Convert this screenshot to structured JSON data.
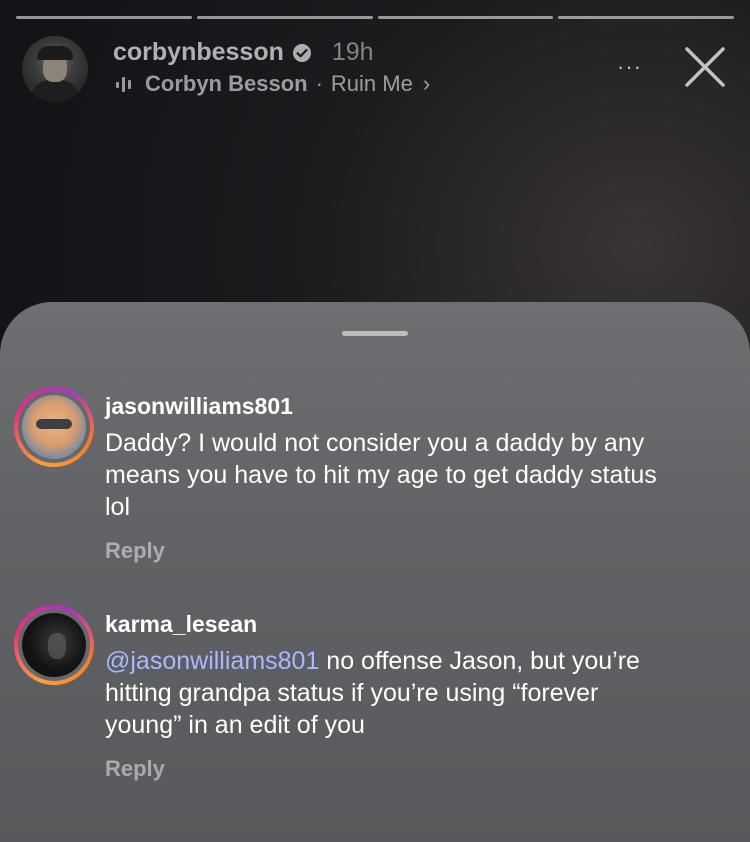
{
  "story": {
    "username": "corbynbesson",
    "time": "19h",
    "music_artist": "Corbyn Besson",
    "music_separator": "·",
    "music_song": "Ruin Me",
    "more_label": "···",
    "progress_segments": 4,
    "progress_done": 4
  },
  "comments": [
    {
      "username": "jasonwilliams801",
      "mention": "",
      "text": "Daddy? I would not consider you a daddy by any means you have to hit my age to get daddy status lol",
      "reply_label": "Reply"
    },
    {
      "username": "karma_lesean",
      "mention": "@jasonwilliams801",
      "text": " no offense Jason, but you’re hitting grandpa status if you’re using “forever young” in an edit of you",
      "reply_label": "Reply"
    }
  ],
  "icons": {
    "verified": "verified-badge-icon",
    "music": "music-bars-icon",
    "chevron": "chevron-right-icon",
    "close": "close-icon",
    "more": "more-dots-icon"
  },
  "colors": {
    "mention": "#a9b8ff",
    "sheet": "#636467"
  }
}
